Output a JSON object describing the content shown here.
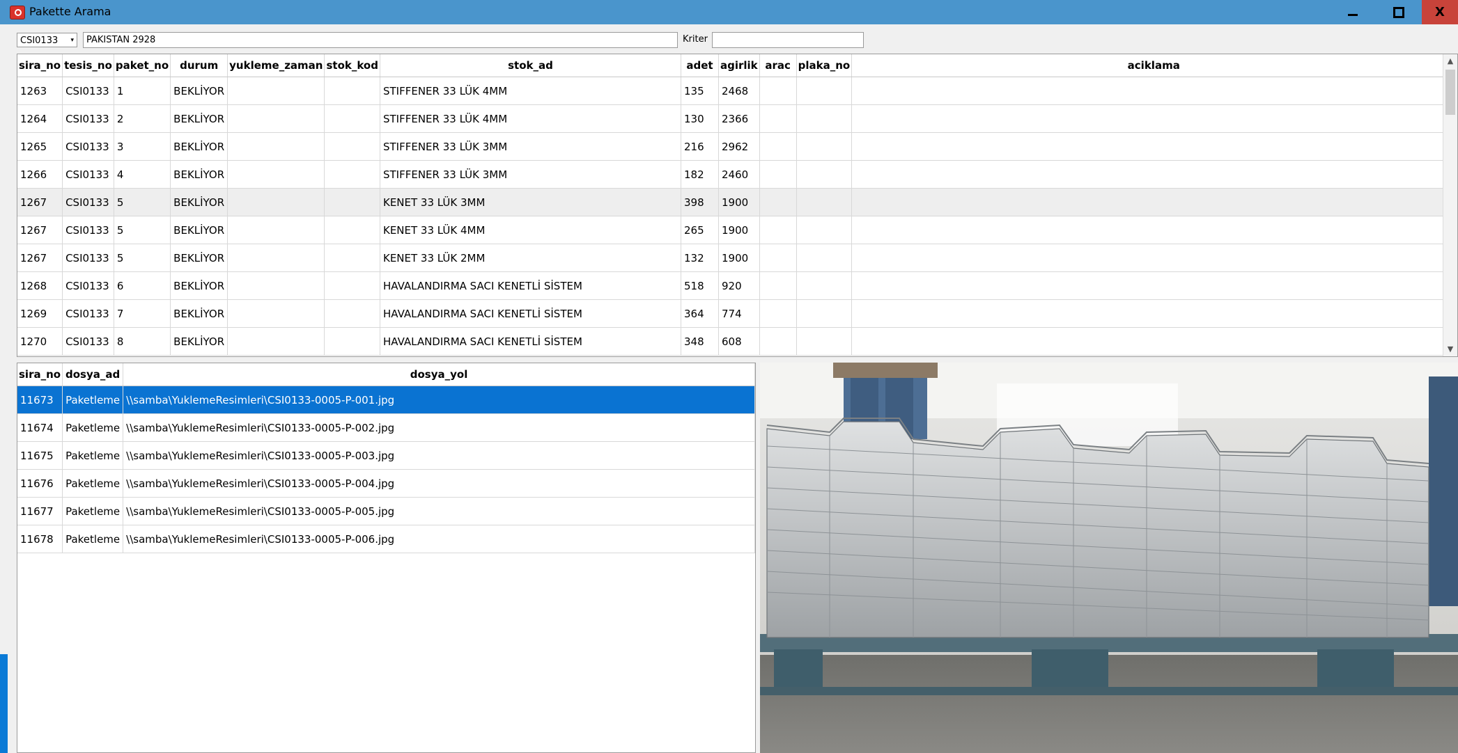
{
  "window": {
    "title": "Pakette Arama",
    "controls": {
      "minimize": "minimize",
      "restore": "restore",
      "close": "X"
    }
  },
  "filters": {
    "facility_value": "CSI0133",
    "name_value": "PAKİSTAN 2928",
    "kriter_label": "Kriter",
    "kriter_value": ""
  },
  "packages_grid": {
    "columns": [
      "sira_no",
      "tesis_no",
      "paket_no",
      "durum",
      "yukleme_zaman",
      "stok_kod",
      "stok_ad",
      "adet",
      "agirlik",
      "arac",
      "plaka_no",
      "aciklama"
    ],
    "rows": [
      [
        "1263",
        "CSI0133",
        "1",
        "BEKLİYOR",
        "",
        "",
        "STIFFENER 33 LÜK 4MM",
        "135",
        "2468",
        "",
        "",
        ""
      ],
      [
        "1264",
        "CSI0133",
        "2",
        "BEKLİYOR",
        "",
        "",
        "STIFFENER 33 LÜK 4MM",
        "130",
        "2366",
        "",
        "",
        ""
      ],
      [
        "1265",
        "CSI0133",
        "3",
        "BEKLİYOR",
        "",
        "",
        "STIFFENER 33 LÜK 3MM",
        "216",
        "2962",
        "",
        "",
        ""
      ],
      [
        "1266",
        "CSI0133",
        "4",
        "BEKLİYOR",
        "",
        "",
        "STIFFENER 33 LÜK 3MM",
        "182",
        "2460",
        "",
        "",
        ""
      ],
      [
        "1267",
        "CSI0133",
        "5",
        "BEKLİYOR",
        "",
        "",
        "KENET 33 LÜK 3MM",
        "398",
        "1900",
        "",
        "",
        ""
      ],
      [
        "1267",
        "CSI0133",
        "5",
        "BEKLİYOR",
        "",
        "",
        "KENET 33 LÜK 4MM",
        "265",
        "1900",
        "",
        "",
        ""
      ],
      [
        "1267",
        "CSI0133",
        "5",
        "BEKLİYOR",
        "",
        "",
        "KENET 33 LÜK 2MM",
        "132",
        "1900",
        "",
        "",
        ""
      ],
      [
        "1268",
        "CSI0133",
        "6",
        "BEKLİYOR",
        "",
        "",
        "HAVALANDIRMA SACI KENETLİ SİSTEM",
        "518",
        "920",
        "",
        "",
        ""
      ],
      [
        "1269",
        "CSI0133",
        "7",
        "BEKLİYOR",
        "",
        "",
        "HAVALANDIRMA SACI KENETLİ SİSTEM",
        "364",
        "774",
        "",
        "",
        ""
      ],
      [
        "1270",
        "CSI0133",
        "8",
        "BEKLİYOR",
        "",
        "",
        "HAVALANDIRMA SACI KENETLİ SİSTEM",
        "348",
        "608",
        "",
        "",
        ""
      ]
    ],
    "highlighted_row": 4
  },
  "files_grid": {
    "columns": [
      "sira_no",
      "dosya_ad",
      "dosya_yol"
    ],
    "rows": [
      [
        "11673",
        "Paketleme",
        "\\\\samba\\YuklemeResimleri\\CSI0133-0005-P-001.jpg"
      ],
      [
        "11674",
        "Paketleme",
        "\\\\samba\\YuklemeResimleri\\CSI0133-0005-P-002.jpg"
      ],
      [
        "11675",
        "Paketleme",
        "\\\\samba\\YuklemeResimleri\\CSI0133-0005-P-003.jpg"
      ],
      [
        "11676",
        "Paketleme",
        "\\\\samba\\YuklemeResimleri\\CSI0133-0005-P-004.jpg"
      ],
      [
        "11677",
        "Paketleme",
        "\\\\samba\\YuklemeResimleri\\CSI0133-0005-P-005.jpg"
      ],
      [
        "11678",
        "Paketleme",
        "\\\\samba\\YuklemeResimleri\\CSI0133-0005-P-006.jpg"
      ]
    ],
    "selected_row": 0
  },
  "colors": {
    "titlebar": "#4a95cc",
    "close_button": "#c8433a",
    "selection": "#0a73d2",
    "row_highlight": "#eeeeee"
  }
}
